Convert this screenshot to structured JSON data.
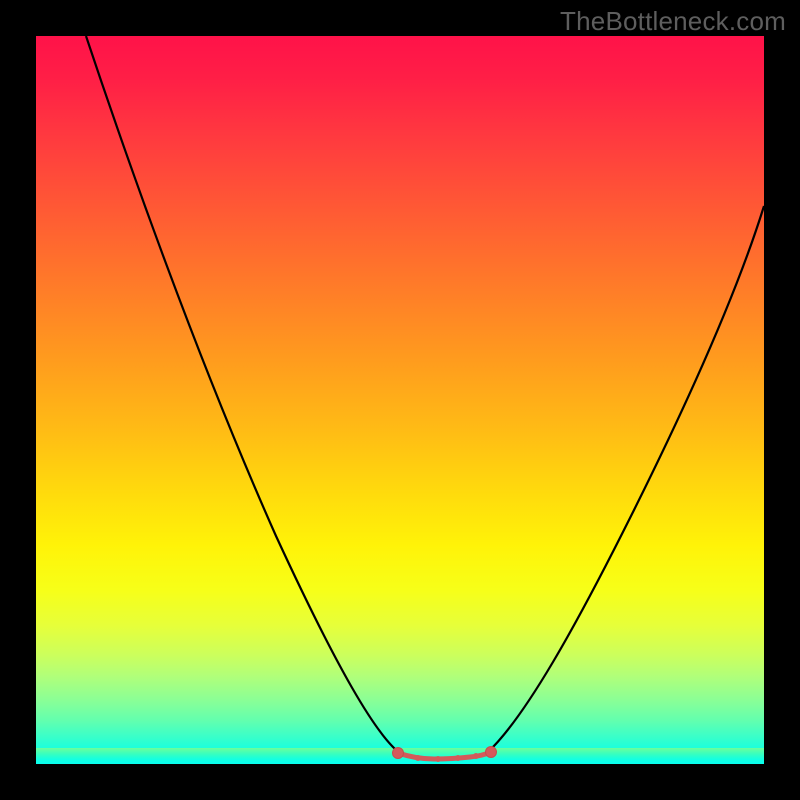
{
  "watermark": "TheBottleneck.com",
  "colors": {
    "page_bg": "#000000",
    "watermark_text": "#5e5e5e",
    "curve_stroke": "#000000",
    "marker_fill": "#d45a5a",
    "marker_stroke": "#c44f4f"
  },
  "chart_data": {
    "type": "line",
    "title": "",
    "xlabel": "",
    "ylabel": "",
    "xlim": [
      0,
      100
    ],
    "ylim": [
      0,
      100
    ],
    "grid": false,
    "legend": false,
    "background": "vertical-rainbow-gradient red->yellow->green",
    "series": [
      {
        "name": "left-descending-branch",
        "x": [
          7,
          12,
          18,
          24,
          30,
          36,
          42,
          46,
          50
        ],
        "y": [
          100,
          84,
          69,
          56,
          43,
          31,
          19,
          10,
          3
        ]
      },
      {
        "name": "right-ascending-branch",
        "x": [
          62,
          66,
          72,
          78,
          84,
          90,
          96,
          100
        ],
        "y": [
          3,
          9,
          19,
          30,
          42,
          55,
          68,
          77
        ]
      },
      {
        "name": "bottom-valley-markers",
        "x": [
          50,
          52,
          54,
          56,
          58,
          60,
          62
        ],
        "y": [
          1.5,
          1.2,
          1.0,
          1.0,
          1.2,
          1.5,
          2.0
        ]
      }
    ],
    "annotations": []
  }
}
